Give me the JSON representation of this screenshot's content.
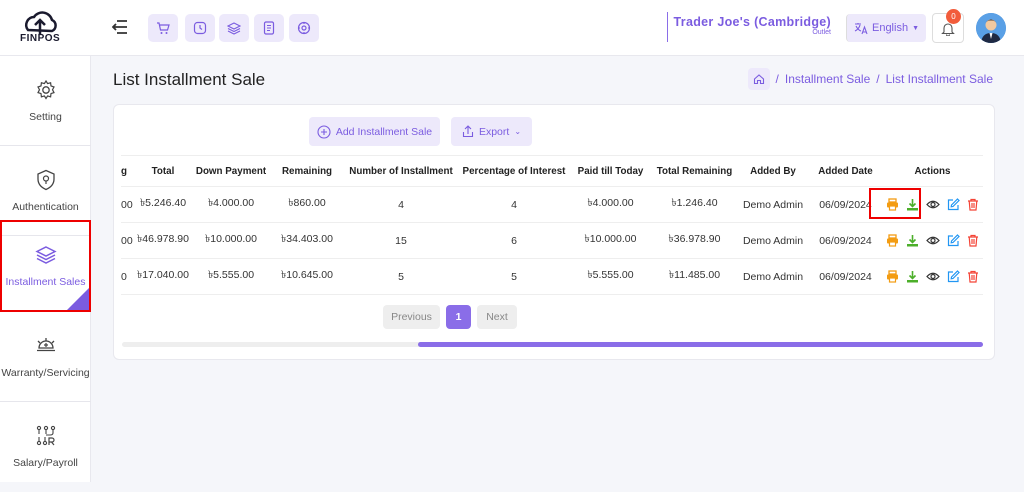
{
  "brand": {
    "logo_text": "FINPOS"
  },
  "header": {
    "store_name": "Trader Joe's (Cambridge)",
    "store_sub": "Outlet",
    "language": "English",
    "notifications": "0"
  },
  "sidebar": {
    "items": [
      {
        "label": "Setting"
      },
      {
        "label": "Authentication"
      },
      {
        "label": "Installment Sales"
      },
      {
        "label": "Warranty/Servicing"
      },
      {
        "label": "Salary/Payroll"
      }
    ]
  },
  "page": {
    "title": "List Installment Sale",
    "breadcrumb": [
      "Installment Sale",
      "List Installment Sale"
    ],
    "separator": "/"
  },
  "toolbar": {
    "add_label": "Add Installment Sale",
    "export_label": "Export"
  },
  "table": {
    "columns": [
      "g",
      "Total",
      "Down Payment",
      "Remaining",
      "Number of Installment",
      "Percentage of Interest",
      "Paid till Today",
      "Total Remaining",
      "Added By",
      "Added Date",
      "Actions"
    ],
    "rows": [
      [
        "00",
        "৳5.246.40",
        "৳4.000.00",
        "৳860.00",
        "4",
        "4",
        "৳4.000.00",
        "৳1.246.40",
        "Demo Admin",
        "06/09/2024"
      ],
      [
        "00",
        "৳46.978.90",
        "৳10.000.00",
        "৳34.403.00",
        "15",
        "6",
        "৳10.000.00",
        "৳36.978.90",
        "Demo Admin",
        "06/09/2024"
      ],
      [
        "0",
        "৳17.040.00",
        "৳5.555.00",
        "৳10.645.00",
        "5",
        "5",
        "৳5.555.00",
        "৳11.485.00",
        "Demo Admin",
        "06/09/2024"
      ]
    ]
  },
  "pagination": {
    "previous": "Previous",
    "current": "1",
    "next": "Next"
  },
  "colors": {
    "accent": "#7b5ce0",
    "print": "#f39c12",
    "download": "#4caf2a",
    "edit": "#2196f3",
    "delete": "#f44336"
  }
}
